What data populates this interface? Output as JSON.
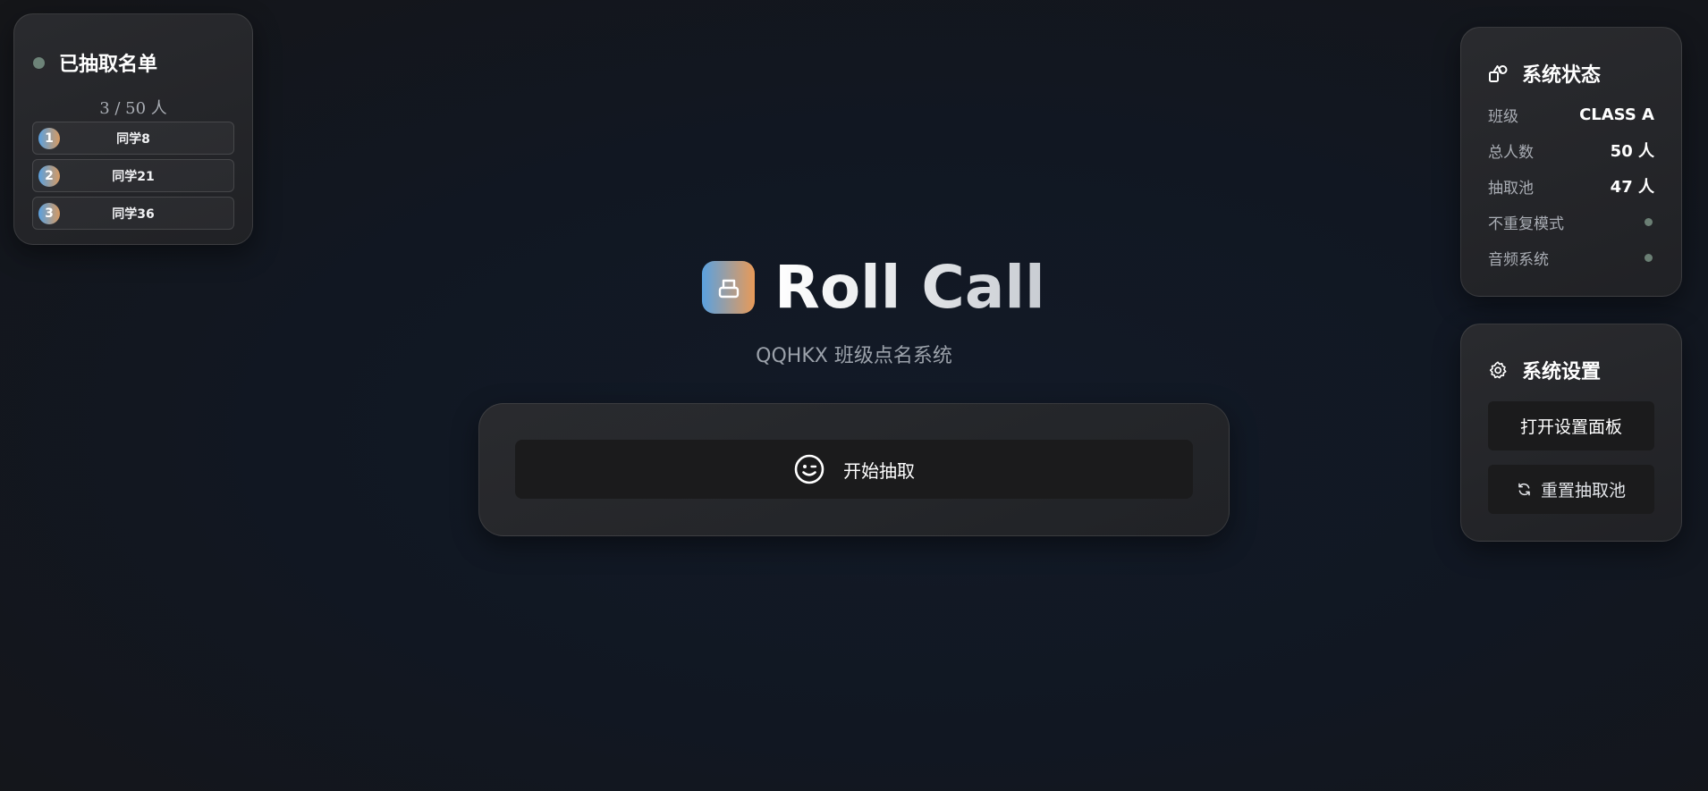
{
  "drawn_panel": {
    "title": "已抽取名单",
    "count_text": "3 / 50 人",
    "items": [
      {
        "index": "1",
        "name": "同学8"
      },
      {
        "index": "2",
        "name": "同学21"
      },
      {
        "index": "3",
        "name": "同学36"
      }
    ]
  },
  "hero": {
    "title": "Roll Call",
    "subtitle": "QQHKX 班级点名系统",
    "start_button_label": "开始抽取"
  },
  "status_card": {
    "title": "系统状态",
    "rows": [
      {
        "key": "班级",
        "value": "CLASS A"
      },
      {
        "key": "总人数",
        "value": "50 人"
      },
      {
        "key": "抽取池",
        "value": "47 人"
      },
      {
        "key": "不重复模式",
        "value": ""
      },
      {
        "key": "音频系统",
        "value": ""
      }
    ]
  },
  "settings_card": {
    "title": "系统设置",
    "open_settings_label": "打开设置面板",
    "reset_pool_label": "重置抽取池"
  },
  "colors": {
    "accent_gradient_start": "#5aa1e0",
    "accent_gradient_end": "#e89a58",
    "indicator_dot": "#6b7f74",
    "button_bg": "#1b1b1c"
  }
}
